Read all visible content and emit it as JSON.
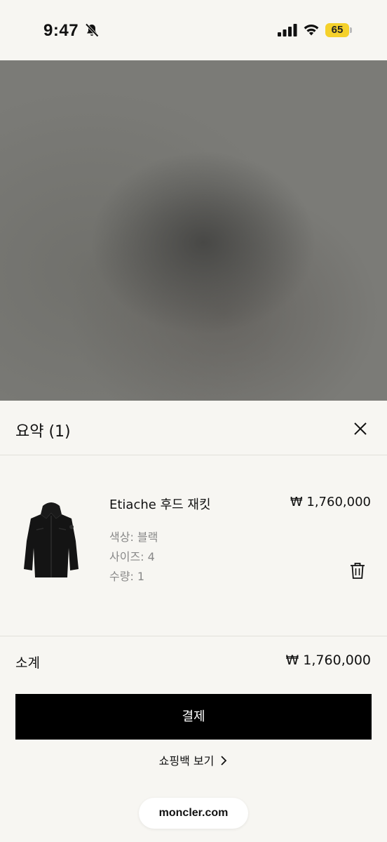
{
  "status_bar": {
    "time": "9:47",
    "battery": "65"
  },
  "summary": {
    "title": "요약 (1)"
  },
  "item": {
    "name": "Etiache 후드 재킷",
    "price": "₩ 1,760,000",
    "color": "색상: 블랙",
    "size": "사이즈: 4",
    "quantity": "수량: 1"
  },
  "subtotal": {
    "label": "소계",
    "value": "₩ 1,760,000"
  },
  "actions": {
    "checkout": "결제",
    "view_bag": "쇼핑백 보기"
  },
  "browser": {
    "url": "moncler.com"
  },
  "icons": {
    "silent": "bell-slash-icon",
    "signal": "cellular-signal-icon",
    "wifi": "wifi-icon",
    "close": "close-icon",
    "delete": "trash-icon",
    "chevron": "chevron-right-icon"
  },
  "colors": {
    "battery": "#f5d12b",
    "checkout_button": "#000000",
    "background": "#f7f6f2"
  }
}
